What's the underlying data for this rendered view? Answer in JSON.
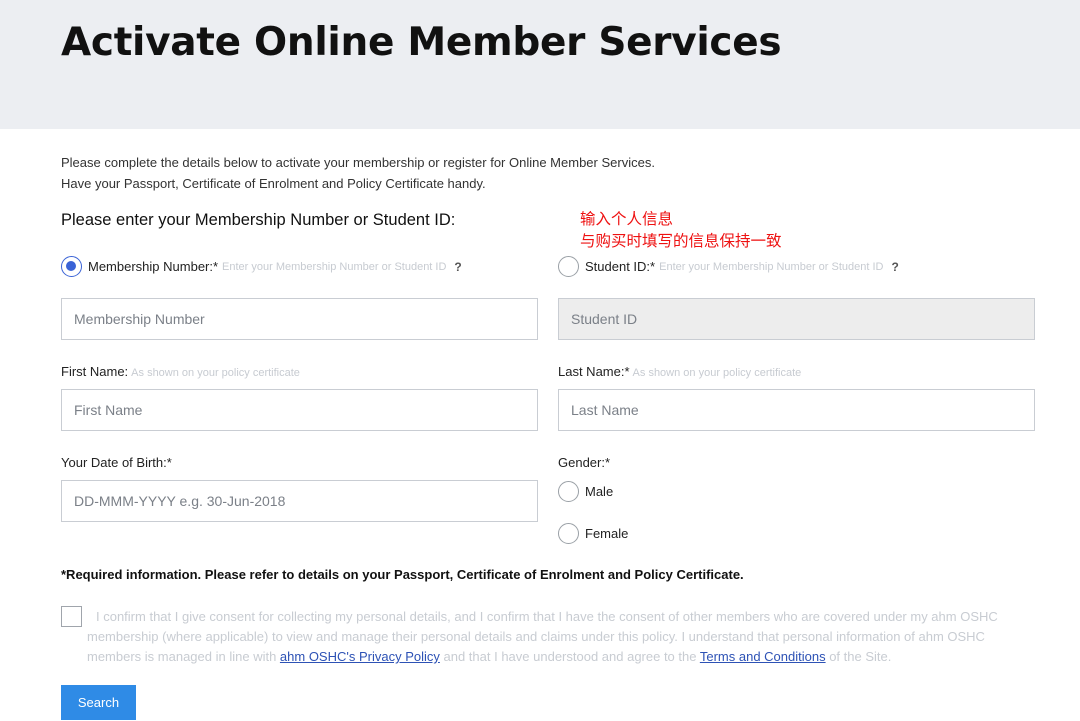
{
  "page": {
    "title": "Activate Online Member Services",
    "intro_line1": "Please complete the details below to activate your membership or register for Online Member Services.",
    "intro_line2": "Have your Passport, Certificate of Enrolment and Policy Certificate handy.",
    "section_title": "Please enter your Membership Number or Student ID:"
  },
  "annotation": {
    "line1": "输入个人信息",
    "line2": "与购买时填写的信息保持一致",
    "color": "#ee1111"
  },
  "id_choice": {
    "membership": {
      "label": "Membership Number:*",
      "hint": "Enter your Membership Number or Student ID",
      "help": "?",
      "selected": true
    },
    "student": {
      "label": "Student ID:*",
      "hint": "Enter your Membership Number or Student ID",
      "help": "?",
      "selected": false
    }
  },
  "fields": {
    "membership_number": {
      "placeholder": "Membership Number",
      "value": ""
    },
    "student_id": {
      "placeholder": "Student ID",
      "value": "",
      "disabled": true
    },
    "first_name": {
      "label": "First Name:",
      "hint": "As shown on your policy certificate",
      "placeholder": "First Name",
      "value": ""
    },
    "last_name": {
      "label": "Last Name:*",
      "hint": "As shown on your policy certificate",
      "placeholder": "Last Name",
      "value": ""
    },
    "dob": {
      "label": "Your Date of Birth:*",
      "placeholder": "DD-MMM-YYYY e.g. 30-Jun-2018",
      "value": ""
    }
  },
  "gender": {
    "label": "Gender:*",
    "options": [
      "Male",
      "Female"
    ],
    "selected": null
  },
  "required_note": "*Required information. Please refer to details on your Passport, Certificate of Enrolment and Policy Certificate.",
  "consent": {
    "checked": false,
    "text_before": "I confirm that I give consent for collecting my personal details, and I confirm that I have the consent of other members who are covered under my ahm OSHC membership (where applicable) to view and manage their personal details and claims under this policy. I understand that personal information of ahm OSHC members is managed in line with ",
    "privacy_link": "ahm OSHC's Privacy Policy",
    "text_middle": " and that I have understood and agree to the ",
    "terms_link": "Terms and Conditions",
    "text_after": " of the Site."
  },
  "actions": {
    "search_label": "Search"
  },
  "colors": {
    "accent": "#3a63d6",
    "button": "#2f8be6",
    "header_bg": "#eceef2",
    "link": "#2d52b5"
  }
}
